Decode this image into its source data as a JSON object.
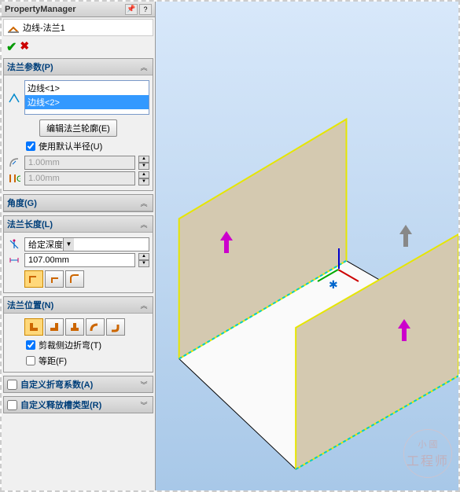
{
  "header": {
    "title": "PropertyManager"
  },
  "feature": {
    "name": "边线-法兰1"
  },
  "params": {
    "title": "法兰参数(P)",
    "edges": [
      "边线<1>",
      "边线<2>"
    ],
    "editProfileBtn": "编辑法兰轮廓(E)",
    "useDefaultRadius": "使用默认半径(U)",
    "radius": "1.00mm",
    "gap": "1.00mm"
  },
  "angle": {
    "title": "角度(G)"
  },
  "length": {
    "title": "法兰长度(L)",
    "type": "给定深度",
    "value": "107.00mm"
  },
  "position": {
    "title": "法兰位置(N)",
    "trimBends": "剪裁侧边折弯(T)",
    "offset": "等距(F)"
  },
  "customBend": {
    "title": "自定义折弯系数(A)"
  },
  "customRelief": {
    "title": "自定义释放槽类型(R)"
  },
  "watermark": {
    "small": "小 國",
    "big": "工程师"
  }
}
